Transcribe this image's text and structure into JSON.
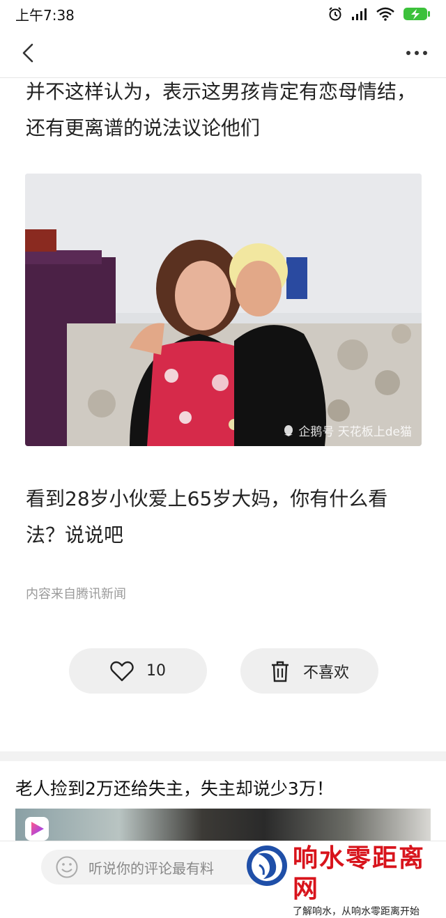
{
  "status_bar": {
    "time": "上午7:38",
    "battery_color": "#3cc13b"
  },
  "article": {
    "para1": "并不这样认为，表示这男孩肯定有恋母情结，还有更离谱的说法议论他们",
    "photo_watermark": "企鹅号 天花板上de猫",
    "para2": "看到28岁小伙爱上65岁大妈，你有什么看法？说说吧",
    "source": "内容来自腾讯新闻"
  },
  "actions": {
    "like_count": "10",
    "dislike_label": "不喜欢"
  },
  "recommendation": {
    "title": "老人捡到2万还给失主，失主却说少3万！"
  },
  "comment_bar": {
    "placeholder": "听说你的评论最有料"
  },
  "watermark_brand": {
    "name": "响水零距离网",
    "slogan": "了解响水，从响水零距离开始",
    "color": "#d8141c"
  }
}
